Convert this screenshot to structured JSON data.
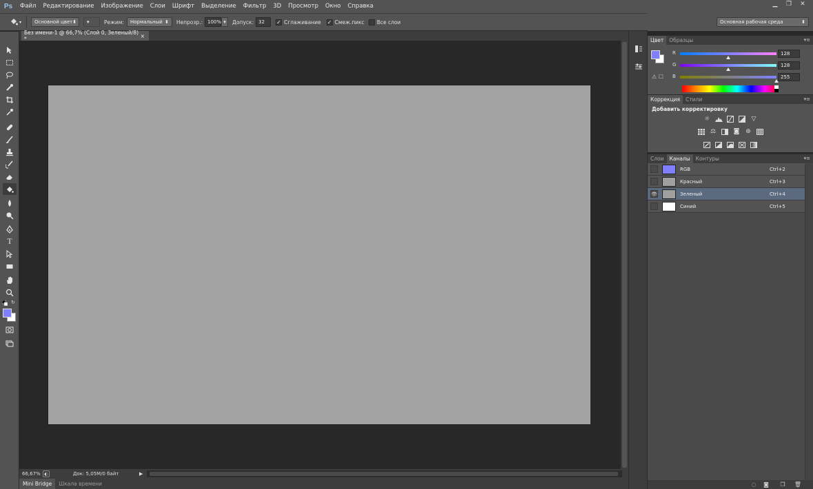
{
  "app": {
    "logo": "Ps"
  },
  "menu": [
    "Файл",
    "Редактирование",
    "Изображение",
    "Слои",
    "Шрифт",
    "Выделение",
    "Фильтр",
    "3D",
    "Просмотр",
    "Окно",
    "Справка"
  ],
  "window_controls": {
    "minimize": "▁",
    "restore": "❐",
    "close": "✕"
  },
  "options": {
    "fill_source": "Основной цвет",
    "mode_label": "Режим:",
    "mode_value": "Нормальный",
    "opacity_label": "Непрозр.:",
    "opacity_value": "100%",
    "tolerance_label": "Допуск:",
    "tolerance_value": "32",
    "antialias_label": "Сглаживание",
    "contiguous_label": "Смеж.пикс",
    "all_layers_label": "Все слои",
    "workspace": "Основная рабочая среда"
  },
  "document": {
    "tab_title": "Без имени-1 @ 66,7% (Слой 0, Зеленый/8) *",
    "tab_close": "×",
    "zoom": "66,67%",
    "doc_info": "Док: 5,05M/0 байт"
  },
  "bottom_tabs": [
    "Mini Bridge",
    "Шкала времени"
  ],
  "color_panel": {
    "tabs": [
      "Цвет",
      "Образцы"
    ],
    "foreground": "#8080ff",
    "background": "#ffffff",
    "channels": [
      {
        "label": "R",
        "value": "128",
        "fraction": 0.5
      },
      {
        "label": "G",
        "value": "128",
        "fraction": 0.5
      },
      {
        "label": "B",
        "value": "255",
        "fraction": 1.0
      }
    ]
  },
  "adjustments_panel": {
    "tabs": [
      "Коррекция",
      "Стили"
    ],
    "title": "Добавить корректировку"
  },
  "channels_panel": {
    "tabs": [
      "Слои",
      "Каналы",
      "Контуры"
    ],
    "rows": [
      {
        "name": "RGB",
        "shortcut": "Ctrl+2",
        "color": "#8080ff",
        "visible": false,
        "selected": false
      },
      {
        "name": "Красный",
        "shortcut": "Ctrl+3",
        "color": "#a0a0a0",
        "visible": false,
        "selected": false
      },
      {
        "name": "Зеленый",
        "shortcut": "Ctrl+4",
        "color": "#a0a0a0",
        "visible": true,
        "selected": true
      },
      {
        "name": "Синий",
        "shortcut": "Ctrl+5",
        "color": "#ffffff",
        "visible": false,
        "selected": false
      }
    ]
  },
  "colors": {
    "canvas": "#a2a2a2",
    "selected_row": "#5c6a80",
    "accent": "#9cc4f0"
  }
}
